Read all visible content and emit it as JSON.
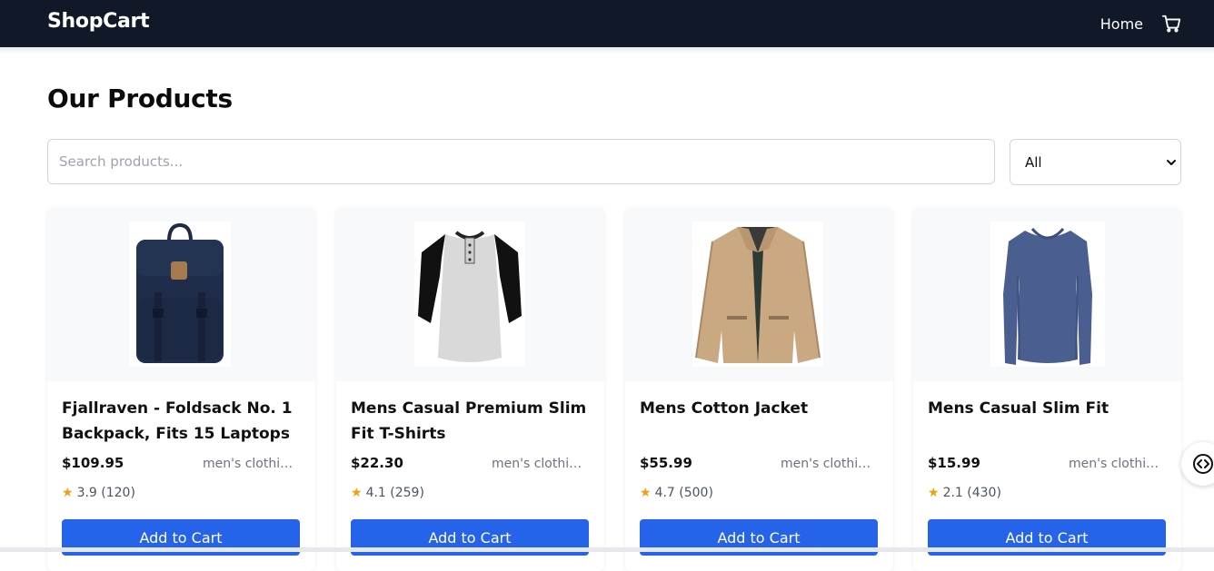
{
  "navbar": {
    "brand": "ShopCart",
    "home_label": "Home",
    "cart_icon": "cart-icon"
  },
  "page": {
    "title": "Our Products"
  },
  "search": {
    "placeholder": "Search products...",
    "value": ""
  },
  "category_filter": {
    "selected": "All"
  },
  "products": [
    {
      "title": "Fjallraven - Foldsack No. 1 Backpack, Fits 15 Laptops",
      "price": "$109.95",
      "category": "men's clothing",
      "rating_text": "3.9 (120)",
      "button_label": "Add to Cart",
      "image": "backpack"
    },
    {
      "title": "Mens Casual Premium Slim Fit T-Shirts",
      "price": "$22.30",
      "category": "men's clothing",
      "rating_text": "4.1 (259)",
      "button_label": "Add to Cart",
      "image": "raglan-tshirt"
    },
    {
      "title": "Mens Cotton Jacket",
      "price": "$55.99",
      "category": "men's clothing",
      "rating_text": "4.7 (500)",
      "button_label": "Add to Cart",
      "image": "cotton-jacket"
    },
    {
      "title": "Mens Casual Slim Fit",
      "price": "$15.99",
      "category": "men's clothing",
      "rating_text": "2.1 (430)",
      "button_label": "Add to Cart",
      "image": "longsleeve-shirt"
    }
  ],
  "colors": {
    "navbar_bg": "#111827",
    "button_bg": "#2563eb",
    "star": "#f59e0b"
  }
}
